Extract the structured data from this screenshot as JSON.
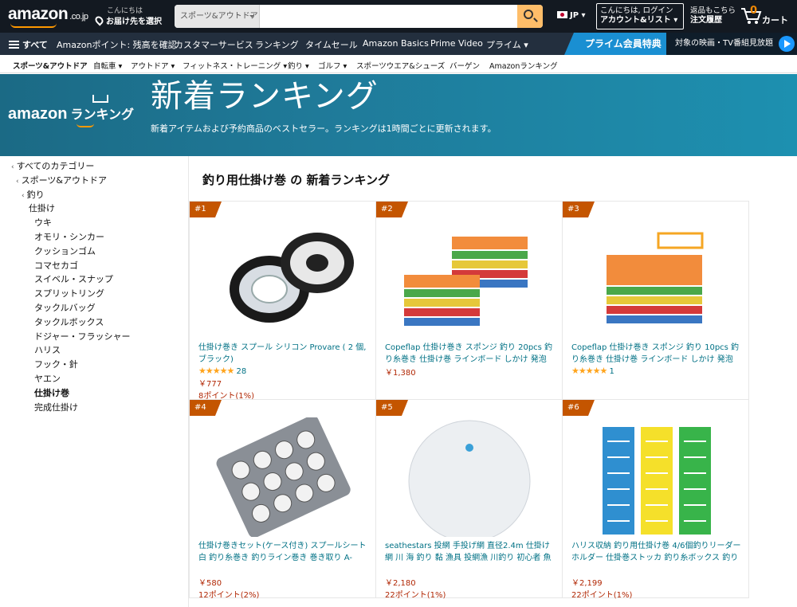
{
  "header": {
    "logo": "amazon",
    "logo_tld": ".co.jp",
    "deliver_line1": "こんにちは",
    "deliver_line2": "お届け先を選択",
    "search_category": "スポーツ&アウトドア",
    "search_placeholder": "",
    "language": "JP",
    "account_line1": "こんにちは, ログイン",
    "account_line2": "アカウント&リスト",
    "orders_line1": "返品もこちら",
    "orders_line2": "注文履歴",
    "cart_count": "0",
    "cart_label": "カート"
  },
  "nav": {
    "all_label": "すべて",
    "items": [
      "Amazonポイント: 残高を確認",
      "カスタマーサービス",
      "ランキング",
      "タイムセール",
      "Amazon Basics",
      "Prime Video",
      "プライム"
    ],
    "prime_banner": "プライム会員特典",
    "prime_video_text": "対象の映画・TV番組見放題"
  },
  "subnav": {
    "items": [
      "スポーツ&アウトドア",
      "自転車",
      "アウトドア",
      "フィットネス・トレーニング",
      "釣り",
      "ゴルフ",
      "スポーツウエア&シューズ",
      "バーゲン",
      "Amazonランキング"
    ]
  },
  "banner": {
    "logo_text": "amazon",
    "logo_sub": "ランキング",
    "title": "新着ランキング",
    "subtitle": "新着アイテムおよび予約商品のベストセラー。ランキングは1時間ごとに更新されます。"
  },
  "sidebar": {
    "items": [
      "すべてのカテゴリー",
      "スポーツ&アウトドア",
      "釣り",
      "仕掛け",
      "ウキ",
      "オモリ・シンカー",
      "クッションゴム",
      "コマセカゴ",
      "スイベル・スナップ",
      "スプリットリング",
      "タックルバッグ",
      "タックルボックス",
      "ドジャー・フラッシャー",
      "ハリス",
      "フック・針",
      "ヤエン",
      "仕掛け巻",
      "完成仕掛け"
    ]
  },
  "main": {
    "title": "釣り用仕掛け巻 の 新着ランキング"
  },
  "products": [
    {
      "rank": "#1",
      "title": "仕掛け巻き スプール シリコン Provare ( 2 個, ブラック)",
      "stars": "★★★★★",
      "reviews": "28",
      "price": "￥777",
      "points": "8ポイント(1%)"
    },
    {
      "rank": "#2",
      "title": "Copeflap 仕掛け巻き スポンジ 釣り 20pcs 釣り糸巻き 仕掛け巻 ラインボード しかけ 発泡",
      "stars": "",
      "reviews": "",
      "price": "￥1,380",
      "points": ""
    },
    {
      "rank": "#3",
      "title": "Copeflap 仕掛け巻き スポンジ 釣り 10pcs 釣り糸巻き 仕掛け巻 ラインボード しかけ 発泡",
      "stars": "★★★★★",
      "reviews": "1",
      "price": "",
      "points": ""
    },
    {
      "rank": "#4",
      "title": "仕掛け巻きセット(ケース付き) スプールシート白 釣り糸巻き 釣りライン巻き 巻き取り A-ITEM エーアイテム",
      "stars": "",
      "reviews": "",
      "price": "￥580",
      "points": "12ポイント(2%)"
    },
    {
      "rank": "#5",
      "title": "seathestars 投網 手投げ網 直径2.4m 仕掛け網 川 海 釣り 黏 漁具 投網漁 川釣り 初心者 魚捕り",
      "stars": "",
      "reviews": "",
      "price": "￥2,180",
      "points": "22ポイント(1%)"
    },
    {
      "rank": "#6",
      "title": "ハリス収納 釣り用仕掛け巻 4/6個釣りリーダーホルダー 仕掛巻ストッカ 釣り糸ボックス 釣り道具収納キット クッション仕掛巻ストッカー…",
      "stars": "",
      "reviews": "",
      "price": "￥2,199",
      "points": "22ポイント(1%)"
    }
  ],
  "colors": {
    "header_bg": "#131921",
    "nav_bg": "#232f3e",
    "accent": "#febd69",
    "rank_badge": "#c45500",
    "link": "#007185",
    "price": "#b12704"
  }
}
